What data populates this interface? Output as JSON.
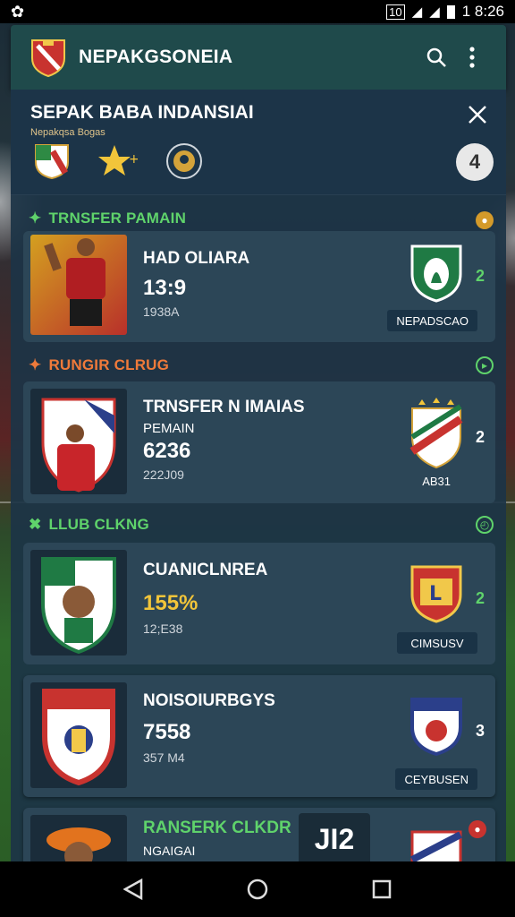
{
  "status": {
    "time": "1 8:26",
    "extra": "10"
  },
  "appbar": {
    "title": "NEPAKGSONEIA"
  },
  "section": {
    "title": "SEPAK BABA INDANSIAI",
    "subtitle": "Nepakqsa Bogas",
    "fab_label": "4"
  },
  "cards": [
    {
      "label": "TRNSFER PAMAIN",
      "label_color": "#5fd36b",
      "name": "HAD OLIARA",
      "num": "13:9",
      "small": "1938A",
      "side_num": "2",
      "pill": "NEPADSCAO"
    },
    {
      "label": "RUNGIR CLRUG",
      "label_color": "#ef7a3a",
      "name": "TRNSFER N IMAIAS",
      "sub": "PEMAIN",
      "num": "6236",
      "small": "222J09",
      "side_num": "2",
      "pill": "AB31"
    },
    {
      "label": "LLUB CLKNG",
      "label_color": "#5fd36b",
      "name": "CUANICLNREA",
      "num": "155%",
      "small": "12;E38",
      "side_num": "2",
      "pill": "CIMSUSV"
    },
    {
      "name": "NOISOIURBGYS",
      "num": "7558",
      "small": "357 M4",
      "side_num": "3",
      "pill": "CEYBUSEN"
    },
    {
      "name": "RANSERK CLKDR",
      "sub": "NGAIGAI",
      "jersey": "JI2"
    }
  ],
  "colors": {
    "accent_green": "#5fd36b",
    "accent_orange": "#ef7a3a",
    "appbar": "#1f4a4b"
  }
}
